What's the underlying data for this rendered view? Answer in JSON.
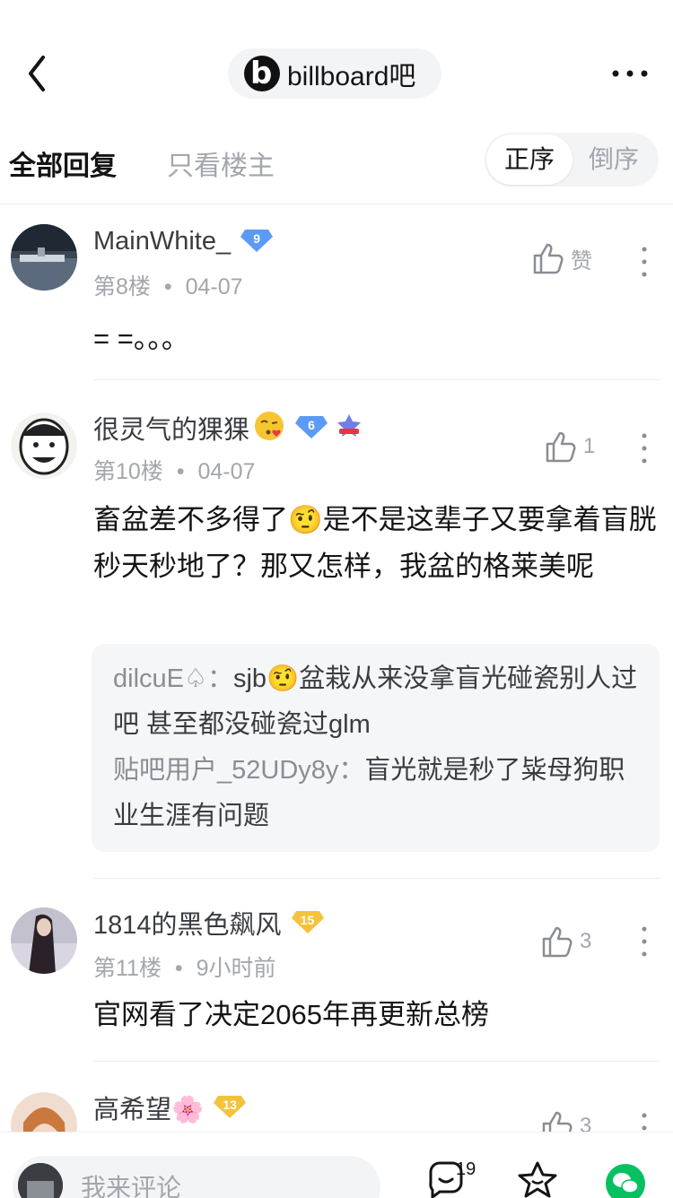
{
  "header": {
    "forum_name": "billboard吧",
    "forum_logo_letter": "b"
  },
  "tabs": {
    "all_replies": "全部回复",
    "op_only": "只看楼主",
    "sort_asc": "正序",
    "sort_desc": "倒序"
  },
  "posts": [
    {
      "username": "MainWhite_",
      "level": "9",
      "floor": "第8楼",
      "date": "04-07",
      "like_label": "赞",
      "content": "= =。。。"
    },
    {
      "username": "很灵气的猓猓",
      "level": "6",
      "floor": "第10楼",
      "date": "04-07",
      "like_count": "1",
      "content": "畜盆差不多得了🤨是不是这辈子又要拿着盲胱秒天秒地了？那又怎样，我盆的格莱美呢",
      "replies": [
        {
          "user": "dilcuE♤：",
          "text": "sjb🤨盆栽从来没拿盲光碰瓷别人过吧 甚至都没碰瓷过glm"
        },
        {
          "user": "贴吧用户_52UDy8y：",
          "text": "盲光就是秒了粊母狗职业生涯有问题"
        }
      ]
    },
    {
      "username": "1814的黑色飙风",
      "level": "15",
      "floor": "第11楼",
      "date": "9小时前",
      "like_count": "3",
      "content": "官网看了决定2065年再更新总榜"
    },
    {
      "username": "高希望🌸",
      "level": "13",
      "like_count": "3"
    }
  ],
  "bottom_bar": {
    "comment_placeholder": "我来评论",
    "reply_count": "19"
  },
  "colors": {
    "badge_blue": "#5b9bf5",
    "badge_gold": "#f5c23b",
    "wechat_green": "#07c160"
  }
}
